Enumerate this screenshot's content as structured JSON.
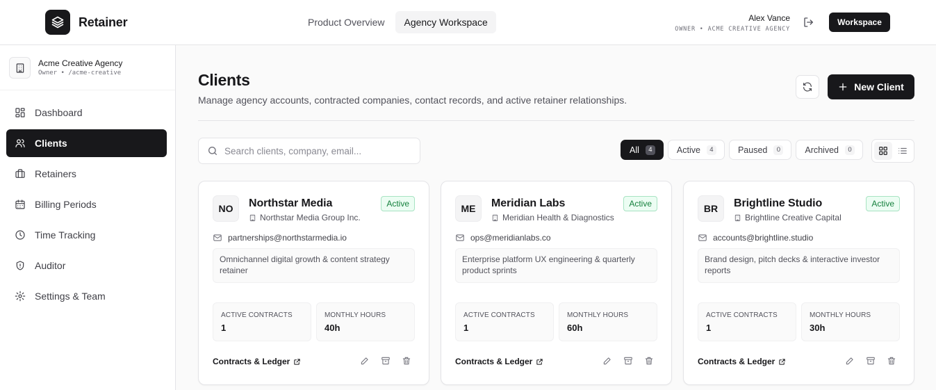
{
  "brand": {
    "name": "Retainer"
  },
  "top_nav": [
    {
      "label": "Product Overview",
      "active": false
    },
    {
      "label": "Agency Workspace",
      "active": true
    }
  ],
  "user": {
    "name": "Alex Vance",
    "role": "OWNER • ACME CREATIVE AGENCY"
  },
  "workspace_button": "Workspace",
  "org": {
    "name": "Acme Creative Agency",
    "sub": "Owner • /acme-creative"
  },
  "sidebar": {
    "items": [
      {
        "label": "Dashboard",
        "icon": "dashboard-icon",
        "active": false
      },
      {
        "label": "Clients",
        "icon": "users-icon",
        "active": true
      },
      {
        "label": "Retainers",
        "icon": "briefcase-icon",
        "active": false
      },
      {
        "label": "Billing Periods",
        "icon": "calendar-icon",
        "active": false
      },
      {
        "label": "Time Tracking",
        "icon": "clock-icon",
        "active": false
      },
      {
        "label": "Auditor",
        "icon": "shield-icon",
        "active": false
      },
      {
        "label": "Settings & Team",
        "icon": "gear-icon",
        "active": false
      }
    ]
  },
  "page": {
    "title": "Clients",
    "subtitle": "Manage agency accounts, contracted companies, contact records, and active retainer relationships.",
    "new_button": "New Client"
  },
  "search": {
    "placeholder": "Search clients, company, email...",
    "value": ""
  },
  "filters": [
    {
      "label": "All",
      "count": "4",
      "active": true
    },
    {
      "label": "Active",
      "count": "4",
      "active": false
    },
    {
      "label": "Paused",
      "count": "0",
      "active": false
    },
    {
      "label": "Archived",
      "count": "0",
      "active": false
    }
  ],
  "cards": [
    {
      "initials": "NO",
      "name": "Northstar Media",
      "company": "Northstar Media Group Inc.",
      "status": "Active",
      "email": "partnerships@northstarmedia.io",
      "description": "Omnichannel digital growth & content strategy retainer",
      "stat1_label": "ACTIVE CONTRACTS",
      "stat1_value": "1",
      "stat2_label": "MONTHLY HOURS",
      "stat2_value": "40h",
      "link": "Contracts & Ledger"
    },
    {
      "initials": "ME",
      "name": "Meridian Labs",
      "company": "Meridian Health & Diagnostics",
      "status": "Active",
      "email": "ops@meridianlabs.co",
      "description": "Enterprise platform UX engineering & quarterly product sprints",
      "stat1_label": "ACTIVE CONTRACTS",
      "stat1_value": "1",
      "stat2_label": "MONTHLY HOURS",
      "stat2_value": "60h",
      "link": "Contracts & Ledger"
    },
    {
      "initials": "BR",
      "name": "Brightline Studio",
      "company": "Brightline Creative Capital",
      "status": "Active",
      "email": "accounts@brightline.studio",
      "description": "Brand design, pitch decks & interactive investor reports",
      "stat1_label": "ACTIVE CONTRACTS",
      "stat1_value": "1",
      "stat2_label": "MONTHLY HOURS",
      "stat2_value": "30h",
      "link": "Contracts & Ledger"
    }
  ],
  "colors": {
    "primary": "#18181b",
    "border": "#e4e4e7",
    "badge_bg": "#ecfdf3",
    "badge_text": "#15803d"
  }
}
